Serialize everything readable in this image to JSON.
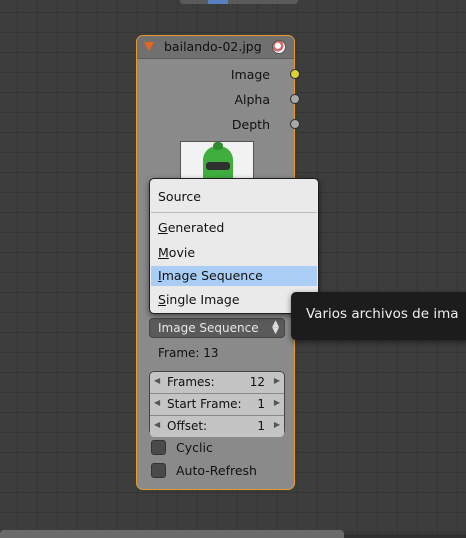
{
  "node": {
    "title": "bailando-02.jpg",
    "outputs": [
      {
        "label": "Image",
        "socket_color": "#d9d13a"
      },
      {
        "label": "Alpha",
        "socket_color": "#a8a8a8"
      },
      {
        "label": "Depth",
        "socket_color": "#a8a8a8"
      }
    ],
    "source_selected": "Image Sequence",
    "frame_text": "Frame: 13",
    "fields": [
      {
        "label": "Frames:",
        "value": "12"
      },
      {
        "label": "Start Frame:",
        "value": "1"
      },
      {
        "label": "Offset:",
        "value": "1"
      }
    ],
    "checkboxes": [
      {
        "label": "Cyclic",
        "checked": false
      },
      {
        "label": "Auto-Refresh",
        "checked": false
      }
    ],
    "border_color": "#e59a2e"
  },
  "menu": {
    "title": "Source",
    "items": [
      {
        "label": "Generated",
        "underline": "G",
        "rest": "enerated",
        "active": false
      },
      {
        "label": "Movie",
        "underline": "M",
        "rest": "ovie",
        "active": false
      },
      {
        "label": "Image Sequence",
        "underline": "I",
        "rest": "mage Sequence",
        "active": true
      },
      {
        "label": "Single Image",
        "underline": "S",
        "rest": "ingle Image",
        "active": false
      }
    ],
    "highlight_color": "#a9cdf5"
  },
  "tooltip": {
    "text": "Varios archivos de ima"
  }
}
